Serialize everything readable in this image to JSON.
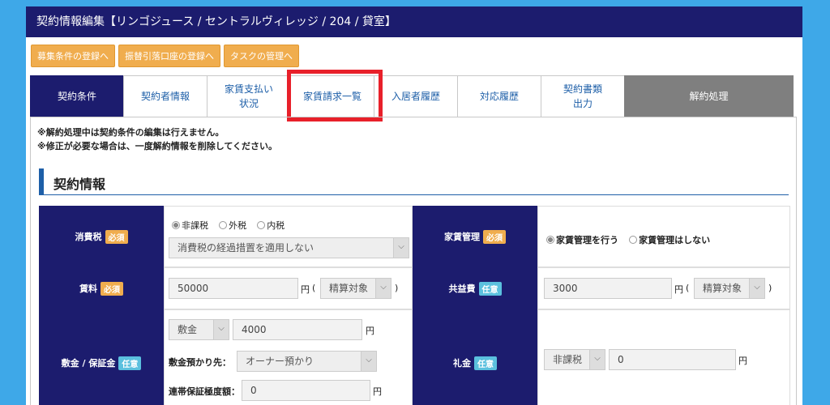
{
  "header": {
    "title": "契約情報編集【リンゴジュース / セントラルヴィレッジ / 204 / 貸室】"
  },
  "actions": [
    "募集条件の登録へ",
    "振替引落口座の登録へ",
    "タスクの管理へ"
  ],
  "tabs": [
    {
      "label": "契約条件",
      "state": "active"
    },
    {
      "label": "契約者情報",
      "state": ""
    },
    {
      "label": "家賃支払い\n状況",
      "state": ""
    },
    {
      "label": "家賃請求一覧",
      "state": "highlighted"
    },
    {
      "label": "入居者履歴",
      "state": ""
    },
    {
      "label": "対応履歴",
      "state": ""
    },
    {
      "label": "契約書類\n出力",
      "state": ""
    },
    {
      "label": "解約処理",
      "state": "dark"
    }
  ],
  "notes": [
    "※解約処理中は契約条件の編集は行えません。",
    "※修正が必要な場合は、一度解約情報を削除してください。"
  ],
  "section": {
    "title": "契約情報"
  },
  "badges": {
    "required": "必須",
    "optional": "任意"
  },
  "yen": "円",
  "paren_open": "(",
  "paren_close": ")",
  "rows": {
    "tax": {
      "label": "消費税",
      "options": [
        "非課税",
        "外税",
        "内税"
      ],
      "selected": "非課税",
      "transition_select": "消費税の経過措置を適用しない"
    },
    "rent_mgmt": {
      "label": "家賃管理",
      "options": [
        "家賃管理を行う",
        "家賃管理はしない"
      ],
      "selected": "家賃管理を行う"
    },
    "rent": {
      "label": "賃料",
      "value": "50000",
      "settle": "精算対象"
    },
    "common": {
      "label": "共益費",
      "value": "3000",
      "settle": "精算対象"
    },
    "deposit": {
      "label": "敷金 / 保証金",
      "type_select": "敷金",
      "value": "4000",
      "holder_label": "敷金預かり先：",
      "holder_select": "オーナー預かり",
      "guarantee_label": "連帯保証極度額：",
      "guarantee_value": "0"
    },
    "key_money": {
      "label": "礼金",
      "tax_select": "非課税",
      "value": "0"
    }
  },
  "colors": {
    "navy": "#1c1c6e",
    "orange": "#f0ad4e",
    "highlight_red": "#e8202a",
    "accent_blue": "#1e5fa8"
  }
}
